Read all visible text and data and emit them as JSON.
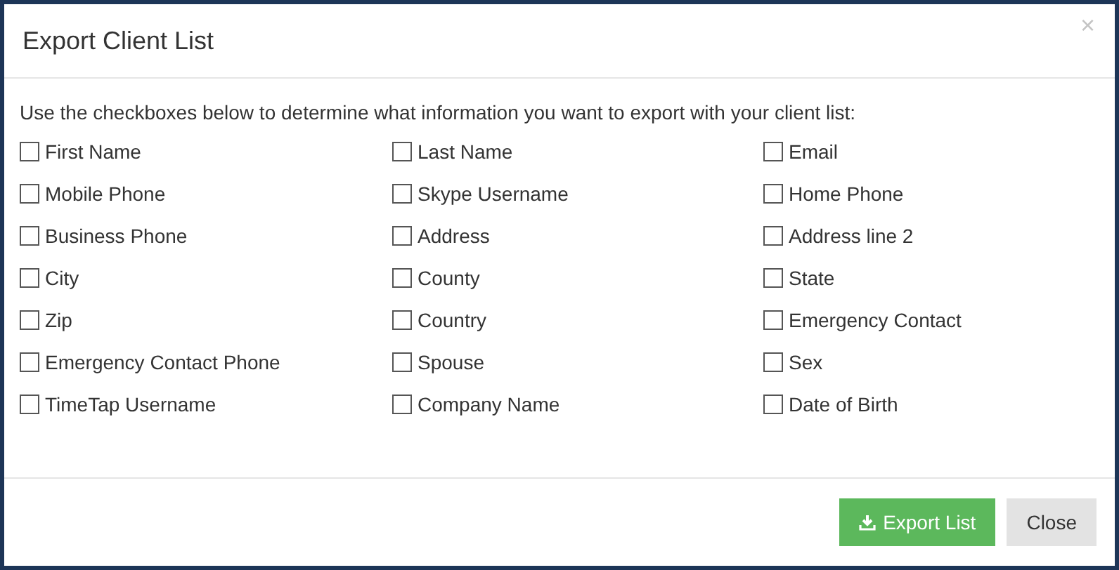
{
  "dialog": {
    "title": "Export Client List",
    "close_glyph": "×"
  },
  "instructions": "Use the checkboxes below to determine what information you want to export with your client list:",
  "fields": [
    {
      "label": "First Name",
      "checked": false
    },
    {
      "label": "Last Name",
      "checked": false
    },
    {
      "label": "Email",
      "checked": false
    },
    {
      "label": "Mobile Phone",
      "checked": false
    },
    {
      "label": "Skype Username",
      "checked": false
    },
    {
      "label": "Home Phone",
      "checked": false
    },
    {
      "label": "Business Phone",
      "checked": false
    },
    {
      "label": "Address",
      "checked": false
    },
    {
      "label": "Address line 2",
      "checked": false
    },
    {
      "label": "City",
      "checked": false
    },
    {
      "label": "County",
      "checked": false
    },
    {
      "label": "State",
      "checked": false
    },
    {
      "label": "Zip",
      "checked": false
    },
    {
      "label": "Country",
      "checked": false
    },
    {
      "label": "Emergency Contact",
      "checked": false
    },
    {
      "label": "Emergency Contact Phone",
      "checked": false
    },
    {
      "label": "Spouse",
      "checked": false
    },
    {
      "label": "Sex",
      "checked": false
    },
    {
      "label": "TimeTap Username",
      "checked": false
    },
    {
      "label": "Company Name",
      "checked": false
    },
    {
      "label": "Date of Birth",
      "checked": false
    }
  ],
  "buttons": [
    {
      "label": "Export List",
      "kind": "primary"
    },
    {
      "label": "Close",
      "kind": "secondary"
    }
  ]
}
